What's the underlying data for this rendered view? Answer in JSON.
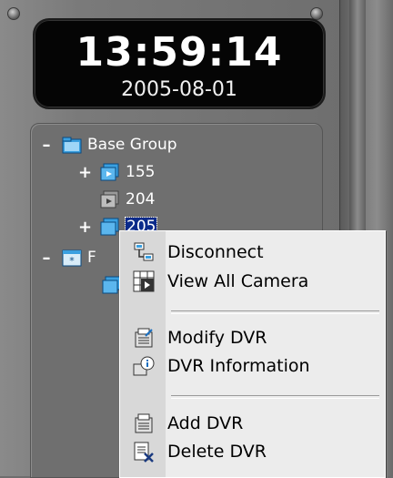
{
  "clock": {
    "time": "13:59:14",
    "date": "2005-08-01"
  },
  "tree": {
    "base_group": {
      "expander": "–",
      "label": "Base Group"
    },
    "items": [
      {
        "expander": "+",
        "label": "155"
      },
      {
        "expander": "",
        "label": "204"
      },
      {
        "expander": "+",
        "label": "205",
        "selected": true
      }
    ],
    "group2": {
      "expander": "–",
      "label": "F"
    }
  },
  "menu": {
    "items": [
      {
        "label": "Disconnect",
        "icon": "disconnect-icon"
      },
      {
        "label": "View All Camera",
        "icon": "view-all-camera-icon"
      },
      {
        "label": "Modify DVR",
        "icon": "modify-dvr-icon"
      },
      {
        "label": "DVR Information",
        "icon": "dvr-information-icon"
      },
      {
        "label": "Add DVR",
        "icon": "add-dvr-icon"
      },
      {
        "label": "Delete DVR",
        "icon": "delete-dvr-icon"
      }
    ]
  },
  "colors": {
    "selection": "#0a2a8a",
    "folder": "#3aa0e0",
    "menu_bg": "#ececec"
  }
}
